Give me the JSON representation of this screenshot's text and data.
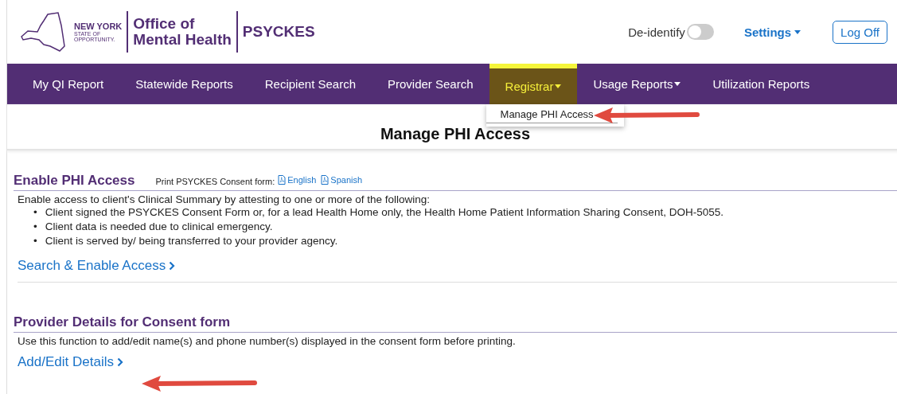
{
  "header": {
    "logo": {
      "state_line1": "NEW YORK",
      "state_line2": "STATE OF",
      "state_line3": "OPPORTUNITY.",
      "office": "Office of\nMental Health",
      "product": "PSYCKES"
    },
    "deidentify": {
      "label": "De-identify",
      "on": false
    },
    "settings": "Settings",
    "logoff": "Log Off"
  },
  "nav": [
    {
      "label": "My QI Report",
      "dropdown": false,
      "selected": false
    },
    {
      "label": "Statewide Reports",
      "dropdown": false,
      "selected": false
    },
    {
      "label": "Recipient Search",
      "dropdown": false,
      "selected": false
    },
    {
      "label": "Provider Search",
      "dropdown": false,
      "selected": false
    },
    {
      "label": "Registrar",
      "dropdown": true,
      "selected": true,
      "menu": [
        "Manage PHI Access"
      ]
    },
    {
      "label": "Usage Reports",
      "dropdown": true,
      "selected": false
    },
    {
      "label": "Utilization Reports",
      "dropdown": false,
      "selected": false
    }
  ],
  "page_title": "Manage PHI Access",
  "sections": [
    {
      "title": "Enable PHI Access",
      "print_label": "Print PSYCKES Consent form:",
      "print_links": [
        "English",
        "Spanish"
      ],
      "intro": "Enable access to client's Clinical Summary by attesting to one or more of the following:",
      "bullet_marker": "•",
      "bullets": [
        "Client signed the PSYCKES Consent Form or, for a lead Health Home only, the Health Home Patient Information Sharing Consent, DOH-5055.",
        "Client data is needed due to clinical emergency.",
        "Client is served by/ being transferred to your provider agency."
      ],
      "action": "Search & Enable Access",
      "divider": true
    },
    {
      "title": "Provider Details for Consent form",
      "intro": "Use this function to add/edit name(s) and phone number(s) displayed in the consent form before printing.",
      "action": "Add/Edit Details",
      "divider": false
    }
  ]
}
